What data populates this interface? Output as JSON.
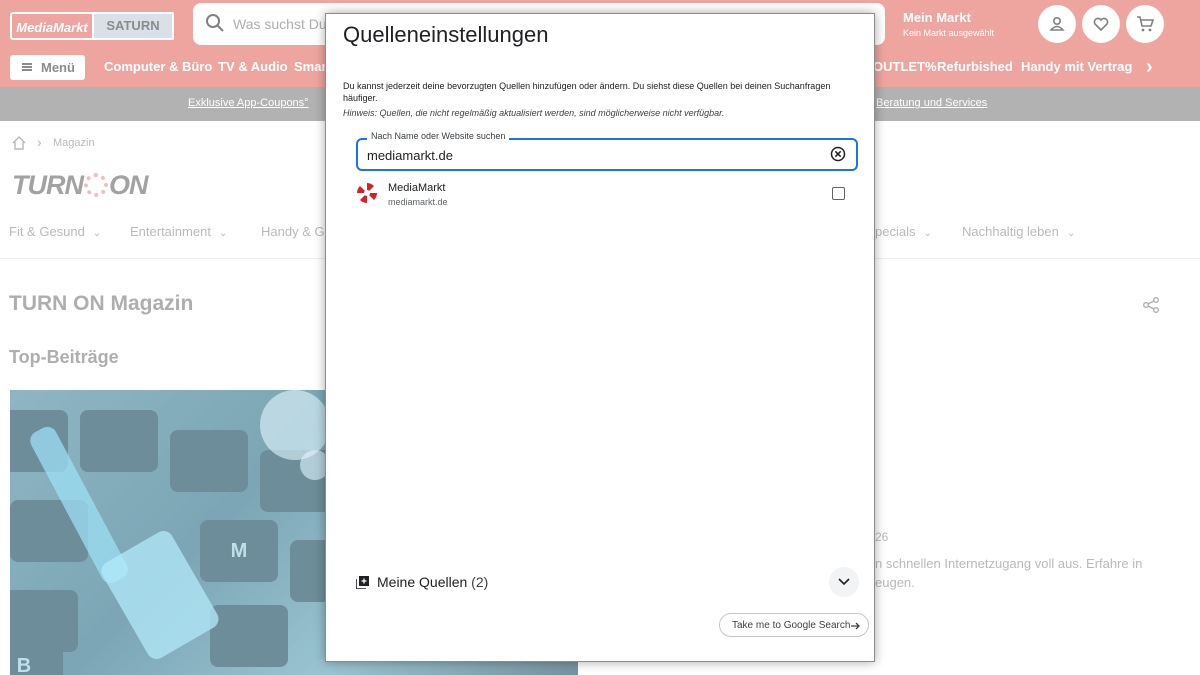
{
  "header": {
    "logo_mediamarkt": "MediaMarkt",
    "logo_saturn": "SATURN",
    "search_placeholder": "Was suchst Du?",
    "mein_markt_title": "Mein Markt",
    "mein_markt_subtitle": "Kein Markt ausgewählt",
    "menu_label": "Menü",
    "nav_items": [
      "Computer & Büro",
      "TV & Audio",
      "Smar",
      "OUTLET%",
      "Refurbished",
      "Handy mit Vertrag"
    ],
    "promo_links": [
      "Exklusive App-Coupons°",
      "Beratung und Services"
    ]
  },
  "breadcrumb": {
    "current": "Magazin"
  },
  "magazine": {
    "logo_left": "TURN",
    "logo_right": "ON",
    "categories": [
      "Fit & Gesund",
      "Entertainment",
      "Handy & Ga",
      "pecials",
      "Nachhaltig leben"
    ],
    "page_title": "TURN ON Magazin",
    "section_title": "Top-Beiträge",
    "side_number": "26",
    "side_text_line1": "n schnellen Internetzugang voll aus. Erfahre in",
    "side_text_line2": "eugen.",
    "hero_keys": [
      "M",
      "B"
    ]
  },
  "modal": {
    "title": "Quelleneinstellungen",
    "description": "Du kannst jederzeit deine bevorzugten Quellen hinzufügen oder ändern. Du siehst diese Quellen bei deinen Suchanfragen häufiger.",
    "hint": "Hinweis: Quellen, die nicht regelmäßig aktualisiert werden, sind möglicherweise nicht verfügbar.",
    "search_label": "Nach Name oder Website suchen",
    "search_value": "mediamarkt.de",
    "result": {
      "name": "MediaMarkt",
      "url": "mediamarkt.de",
      "checked": false
    },
    "my_sources_label": "Meine Quellen",
    "my_sources_count": "(2)",
    "google_button_label": "Take me to Google Search"
  },
  "colors": {
    "brand_red": "#e67b73",
    "focus_blue": "#1a73e8",
    "promo_bar": "#8e8e8e"
  }
}
